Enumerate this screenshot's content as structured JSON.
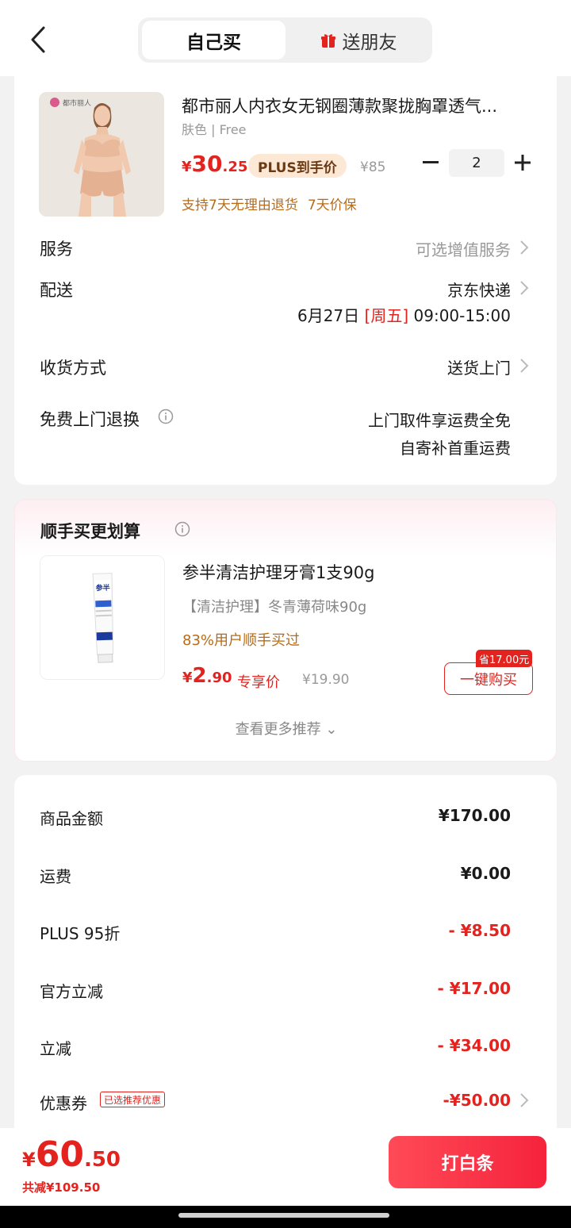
{
  "header": {
    "tab_self": "自己买",
    "tab_gift": "送朋友",
    "gift_icon": "gift-icon",
    "back_icon": "back-arrow-icon"
  },
  "product": {
    "brand_logo_text": "都市丽人",
    "title": "都市丽人内衣女无钢圈薄款聚拢胸罩透气...",
    "spec": "肤色 | Free",
    "price_yen": "¥",
    "price_int": "30",
    "price_dec": ".25",
    "plus_badge": "PLUS到手价",
    "original_price": "¥85",
    "qty_minus": "−",
    "quantity": "2",
    "qty_plus": "+",
    "guarantee_1": "支持7天无理由退货",
    "guarantee_2": "7天价保"
  },
  "order_rows": {
    "service_label": "服务",
    "service_value": "可选增值服务",
    "delivery_label": "配送",
    "delivery_value": "京东快递",
    "delivery_date": "6月27日",
    "delivery_weekday": "[周五]",
    "delivery_time": "09:00-15:00",
    "receive_label": "收货方式",
    "receive_value": "送货上门",
    "return_label": "免费上门退换",
    "return_value_1": "上门取件享运费全免",
    "return_value_2": "自寄补首重运费"
  },
  "recommend": {
    "section_title": "顺手买更划算",
    "item_title": "参半清洁护理牙膏1支90g",
    "item_spec": "【清洁护理】冬青薄荷味90g",
    "item_stat": "83%用户顺手买过",
    "price_yen": "¥",
    "price_int": "2",
    "price_dec": ".90",
    "price_tag": "专享价",
    "original_price": "¥19.90",
    "save_badge": "省17.00元",
    "buy_button": "一键购买",
    "more_link": "查看更多推荐 ⌄",
    "toothpaste_brand": "参半"
  },
  "summary": {
    "goods_label": "商品金额",
    "goods_value": "¥170.00",
    "shipping_label": "运费",
    "shipping_value": "¥0.00",
    "plus_label": "PLUS 95折",
    "plus_value": "- ¥8.50",
    "official_label": "官方立减",
    "official_value": "- ¥17.00",
    "instant_label": "立减",
    "instant_value": "- ¥34.00",
    "coupon_label": "优惠券",
    "coupon_tag": "已选推荐优惠",
    "coupon_value": "-¥50.00"
  },
  "bottom": {
    "total_yen": "¥",
    "total_int": "60",
    "total_dec": ".50",
    "saved": "共减¥109.50",
    "pay_button": "打白条"
  },
  "colors": {
    "accent_red": "#e4231f",
    "promo_orange": "#b86b16",
    "page_bg": "#f2f2f2"
  }
}
